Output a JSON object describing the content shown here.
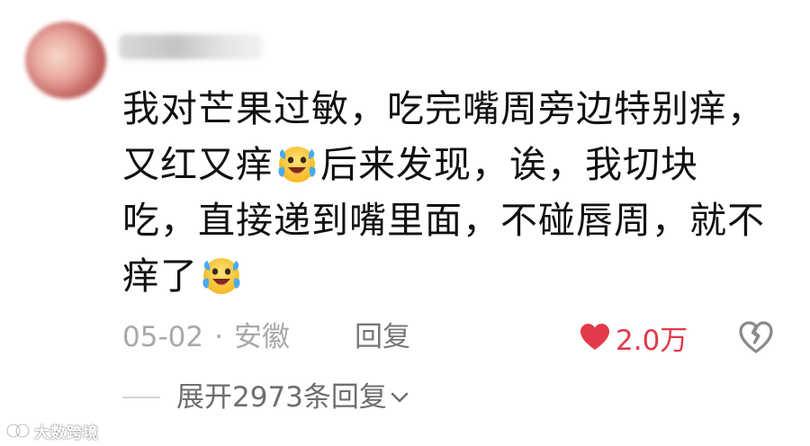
{
  "comment": {
    "username": "",
    "lines": {
      "l1": "我对芒果过敏，吃完嘴周旁边特别痒，",
      "l2a": "又红又痒",
      "l2b": "后来发现，诶，我切块",
      "l3": "吃，直接递到嘴里面，不碰唇周，就不",
      "l4": "痒了"
    },
    "emoji": "laughing-crying-emoji"
  },
  "meta": {
    "date": "05-02",
    "separator": "·",
    "location": "安徽",
    "reply_label": "回复"
  },
  "like": {
    "count": "2.0万",
    "color": "#e23a4a",
    "icon": "heart-icon"
  },
  "dislike": {
    "icon": "broken-heart-icon"
  },
  "replies": {
    "expand_label": "展开2973条回复",
    "icon": "chevron-down-icon"
  },
  "watermark": {
    "text": "大数跨境"
  }
}
